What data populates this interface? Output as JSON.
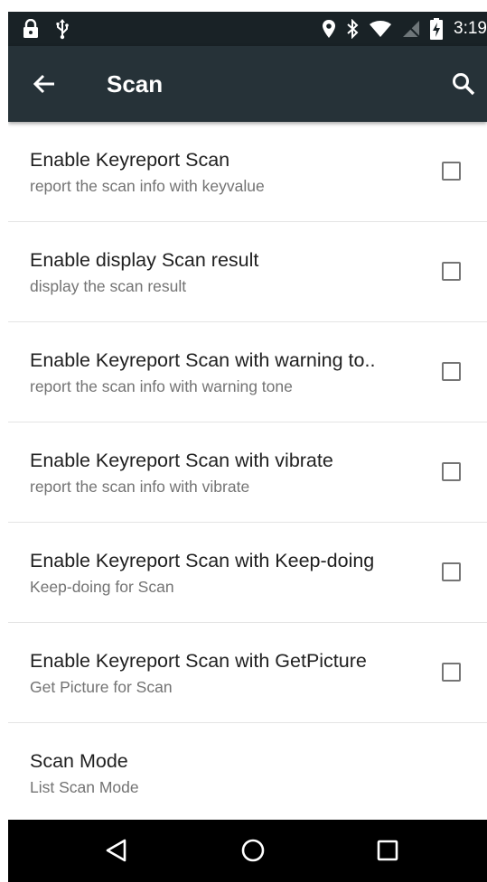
{
  "status_bar": {
    "time": "3:19",
    "left_icons": [
      "lock-icon",
      "usb-icon"
    ],
    "right_icons": [
      "location-icon",
      "bluetooth-icon",
      "wifi-icon",
      "no-sim-icon",
      "battery-charging-icon"
    ]
  },
  "app_bar": {
    "title": "Scan",
    "back_icon": "arrow-back-icon",
    "search_icon": "search-icon"
  },
  "preferences": [
    {
      "title": "Enable Keyreport Scan",
      "summary": "report the scan info with keyvalue",
      "checked": false
    },
    {
      "title": "Enable display Scan result",
      "summary": "display the scan result",
      "checked": false
    },
    {
      "title": "Enable Keyreport Scan with warning to..",
      "summary": "report the scan info with warning tone",
      "checked": false
    },
    {
      "title": "Enable Keyreport Scan with vibrate",
      "summary": "report the scan info with vibrate",
      "checked": false
    },
    {
      "title": "Enable Keyreport Scan with Keep-doing",
      "summary": "Keep-doing for Scan",
      "checked": false
    },
    {
      "title": "Enable Keyreport Scan with GetPicture",
      "summary": "Get Picture for Scan",
      "checked": false
    },
    {
      "title": "Scan Mode",
      "summary": "List Scan Mode"
    }
  ],
  "nav_bar": {
    "icons": [
      "nav-back-icon",
      "nav-home-icon",
      "nav-recents-icon"
    ]
  },
  "colors": {
    "status_bar_bg": "#192226",
    "app_bar_bg": "#263238",
    "title_text": "#212121",
    "summary_text": "#737373",
    "checkbox_border": "#757575",
    "nav_bar_bg": "#000000"
  }
}
